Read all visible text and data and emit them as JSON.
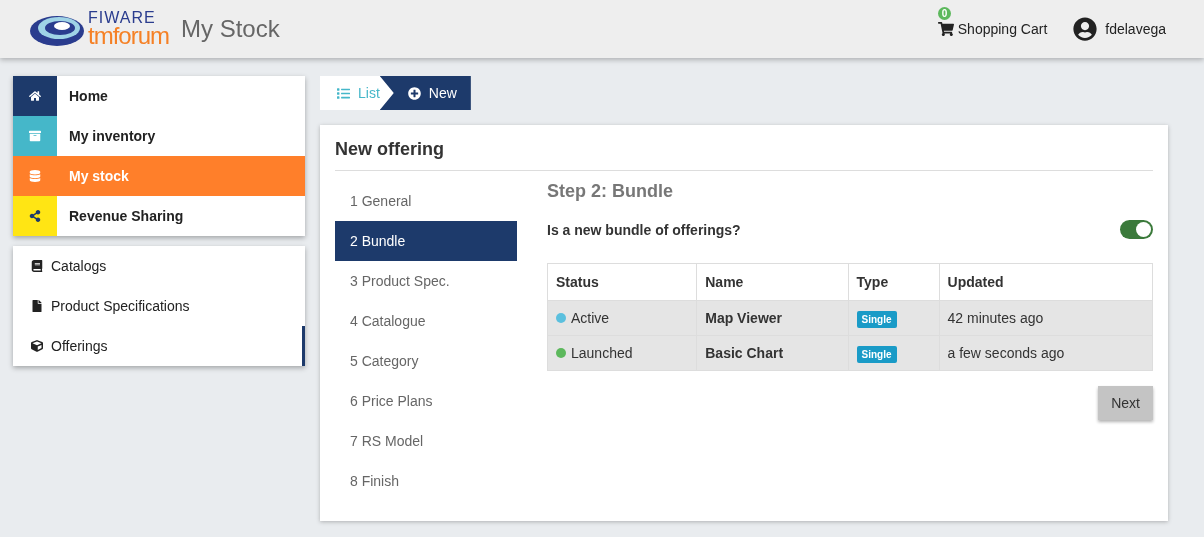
{
  "header": {
    "logo": {
      "top": "FIWARE",
      "bottom": "tmforum"
    },
    "title": "My Stock",
    "cart": {
      "label": "Shopping Cart",
      "count": "0"
    },
    "user": "fdelavega"
  },
  "modules": [
    {
      "label": "Home",
      "color": "#1d3a6b",
      "selected": false
    },
    {
      "label": "My inventory",
      "color": "#45b7c9",
      "selected": false
    },
    {
      "label": "My stock",
      "color": "#ff7f2a",
      "selected": true
    },
    {
      "label": "Revenue Sharing",
      "color": "#ffe514",
      "selected": false
    }
  ],
  "submenu": [
    {
      "label": "Catalogs",
      "selected": false
    },
    {
      "label": "Product Specifications",
      "selected": false
    },
    {
      "label": "Offerings",
      "selected": true
    }
  ],
  "breadcrumb": [
    {
      "label": "List",
      "selected": false
    },
    {
      "label": "New",
      "selected": true
    }
  ],
  "panel": {
    "title": "New offering",
    "steps": [
      {
        "label": "1 General",
        "selected": false
      },
      {
        "label": "2 Bundle",
        "selected": true
      },
      {
        "label": "3 Product Spec.",
        "selected": false
      },
      {
        "label": "4 Catalogue",
        "selected": false
      },
      {
        "label": "5 Category",
        "selected": false
      },
      {
        "label": "6 Price Plans",
        "selected": false
      },
      {
        "label": "7 RS Model",
        "selected": false
      },
      {
        "label": "8 Finish",
        "selected": false
      }
    ],
    "step_title": "Step 2: Bundle",
    "bundle_question": {
      "label": "Is a new bundle of offerings?",
      "on": true
    },
    "table": {
      "columns": [
        "Status",
        "Name",
        "Type",
        "Updated"
      ],
      "rows": [
        {
          "status": "Active",
          "color": "#5bc0de",
          "name": "Map Viewer",
          "type": "Single",
          "updated": "42 minutes ago",
          "selected": true
        },
        {
          "status": "Launched",
          "color": "#5cb85c",
          "name": "Basic Chart",
          "type": "Single",
          "updated": "a few seconds ago",
          "selected": true
        }
      ]
    },
    "next_button": "Next"
  }
}
